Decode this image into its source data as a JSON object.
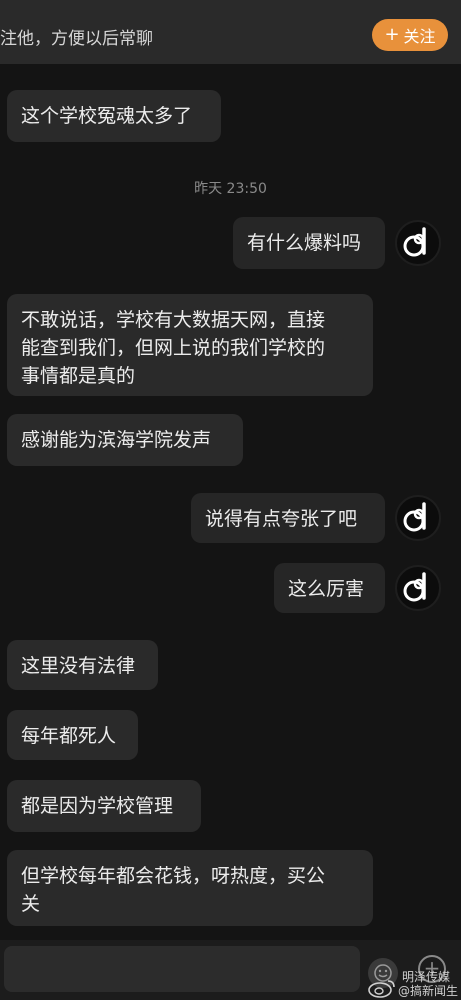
{
  "header": {
    "prompt": "注他，方便以后常聊",
    "follow_label": "关注"
  },
  "messages": [
    {
      "side": "received",
      "text": "这个学校冤魂太多了"
    },
    {
      "side": "sent",
      "text": "有什么爆料吗"
    },
    {
      "side": "received",
      "text": "不敢说话，学校有大数据天网，直接\n能查到我们，但网上说的我们学校的\n事情都是真的"
    },
    {
      "side": "received",
      "text": "感谢能为滨海学院发声"
    },
    {
      "side": "sent",
      "text": "说得有点夸张了吧"
    },
    {
      "side": "sent",
      "text": "这么厉害"
    },
    {
      "side": "received",
      "text": "这里没有法律"
    },
    {
      "side": "received",
      "text": "每年都死人"
    },
    {
      "side": "received",
      "text": "都是因为学校管理"
    },
    {
      "side": "received",
      "text": "但学校每年都会花钱，呀热度，买公\n关"
    }
  ],
  "timestamp": "昨天 23:50",
  "watermark": {
    "line1": "明泽传媒",
    "line2": "@搞新闻生"
  },
  "icons": {
    "follow": "plus-icon",
    "avatar": "user-avatar-logo",
    "emoji": "emoji-icon",
    "more": "plus-circle-icon",
    "watermark": "weibo-logo"
  },
  "colors": {
    "accent": "#e8913b",
    "background": "#141414",
    "bubble": "#2a2a2a"
  }
}
